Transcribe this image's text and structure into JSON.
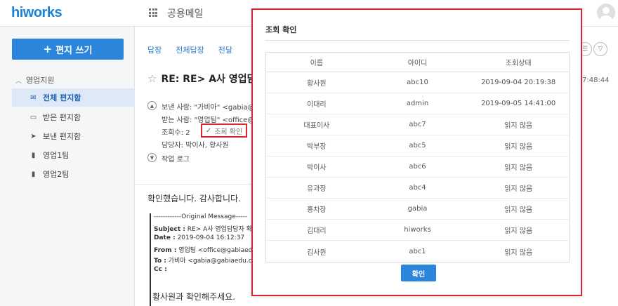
{
  "app": {
    "logo": "hiworks",
    "title": "공용메일"
  },
  "sidebar": {
    "compose_label": "편지 쓰기",
    "group_label": "영업지원",
    "items": [
      {
        "label": "전체 편지함",
        "icon": "envelope-icon"
      },
      {
        "label": "받은 편지함",
        "icon": "inbox-icon"
      },
      {
        "label": "보낸 편지함",
        "icon": "send-icon"
      },
      {
        "label": "영업1팀",
        "icon": "bookmark-icon"
      },
      {
        "label": "영업2팀",
        "icon": "bookmark-icon"
      }
    ]
  },
  "mail": {
    "actions": [
      "답장",
      "전체답장",
      "전달"
    ],
    "subject": "RE: RE> A사 영업담",
    "time": "7:48:44",
    "from": "보낸 사람: \"가비아\" <gabia@",
    "to": "받는 사람: \"영업팀\" <office@",
    "read_count": "조회수: 2",
    "read_check_label": "조회 확인",
    "assignee": "담당자:  박이사, 황사원",
    "work_log": "작업 로그",
    "body_line1": "확인했습니다. 감사합니다.",
    "original": {
      "separator": "------------Original Message-----",
      "subject_label": "Subject :",
      "subject_value": "RE> A사 영업담당자 확",
      "date_label": "Date :",
      "date_value": "2019-09-04 16:12:37",
      "from_label": "From :",
      "from_value": "영업팀 <office@gabiaedu",
      "to_label": "To :",
      "to_value": "가비아 <gabia@gabiaedu.co",
      "cc_label": "Cc :"
    },
    "body_line2": "황사원과 확인해주세요."
  },
  "modal": {
    "title": "조회 확인",
    "columns": [
      "이름",
      "아이디",
      "조회상태"
    ],
    "rows": [
      [
        "황사원",
        "abc10",
        "2019-09-04 20:19:38"
      ],
      [
        "이대리",
        "admin",
        "2019-09-05 14:41:00"
      ],
      [
        "대표이사",
        "abc7",
        "읽지 않음"
      ],
      [
        "박부장",
        "abc5",
        "읽지 않음"
      ],
      [
        "박이사",
        "abc6",
        "읽지 않음"
      ],
      [
        "유과장",
        "abc4",
        "읽지 않음"
      ],
      [
        "홍차장",
        "gabia",
        "읽지 않음"
      ],
      [
        "김대리",
        "hiworks",
        "읽지 않음"
      ],
      [
        "김사원",
        "abc1",
        "읽지 않음"
      ]
    ],
    "confirm_label": "확인"
  },
  "colors": {
    "brand": "#1a82d6",
    "button": "#2b85db",
    "highlight": "#d6262f"
  }
}
